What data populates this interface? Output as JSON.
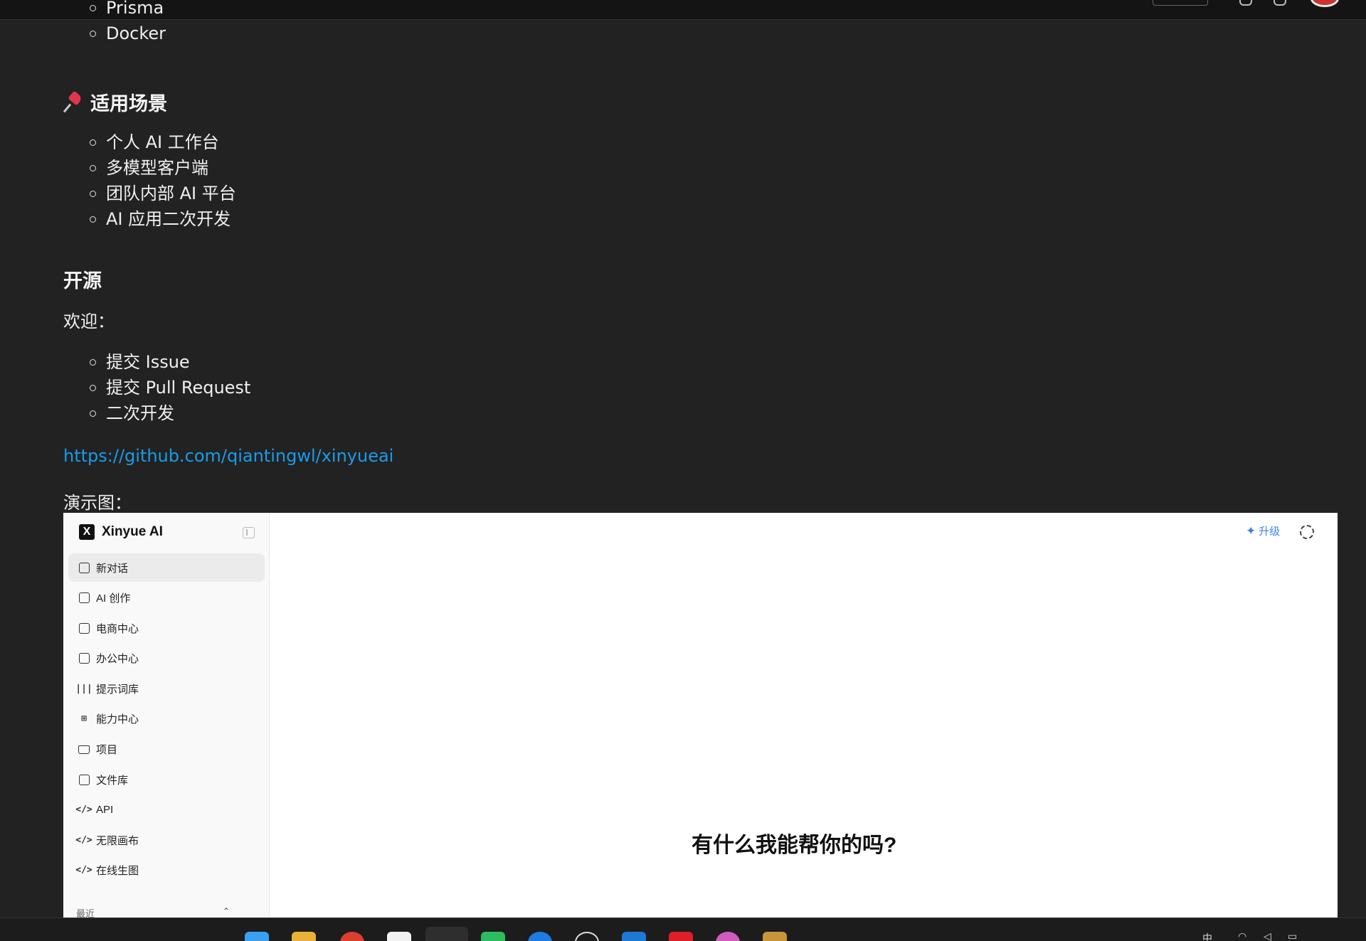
{
  "article": {
    "top_list": [
      "Prisma",
      "Docker"
    ],
    "scenarios_heading": "适用场景",
    "scenarios": [
      "个人 AI 工作台",
      "多模型客户端",
      "团队内部 AI 平台",
      "AI 应用二次开发"
    ],
    "opensource_heading": "开源",
    "welcome_text": "欢迎：",
    "contributions": [
      "提交 Issue",
      "提交 Pull Request",
      "二次开发"
    ],
    "repo_link": "https://github.com/qiantingwl/xinyueai",
    "demo_caption": "演示图："
  },
  "demo": {
    "brand": "Xinyue AI",
    "brand_logo_letter": "X",
    "nav": [
      {
        "label": "新对话",
        "icon": "edit-icon",
        "active": true
      },
      {
        "label": "AI 创作",
        "icon": "image-icon"
      },
      {
        "label": "电商中心",
        "icon": "shopping-bag-icon"
      },
      {
        "label": "办公中心",
        "icon": "briefcase-icon"
      },
      {
        "label": "提示词库",
        "icon": "library-icon"
      },
      {
        "label": "能力中心",
        "icon": "blocks-icon"
      },
      {
        "label": "项目",
        "icon": "folder-icon"
      },
      {
        "label": "文件库",
        "icon": "files-icon"
      },
      {
        "label": "API",
        "icon": "code-icon"
      },
      {
        "label": "无限画布",
        "icon": "code-icon"
      },
      {
        "label": "在线生图",
        "icon": "code-icon"
      }
    ],
    "recent_label": "最近",
    "upgrade_label": "升级",
    "prompt": "有什么我能帮你的吗?"
  },
  "colors": {
    "page_bg": "#222222",
    "link": "#1a9bea",
    "pin": "#e0344f",
    "upgrade": "#3b82f6"
  }
}
